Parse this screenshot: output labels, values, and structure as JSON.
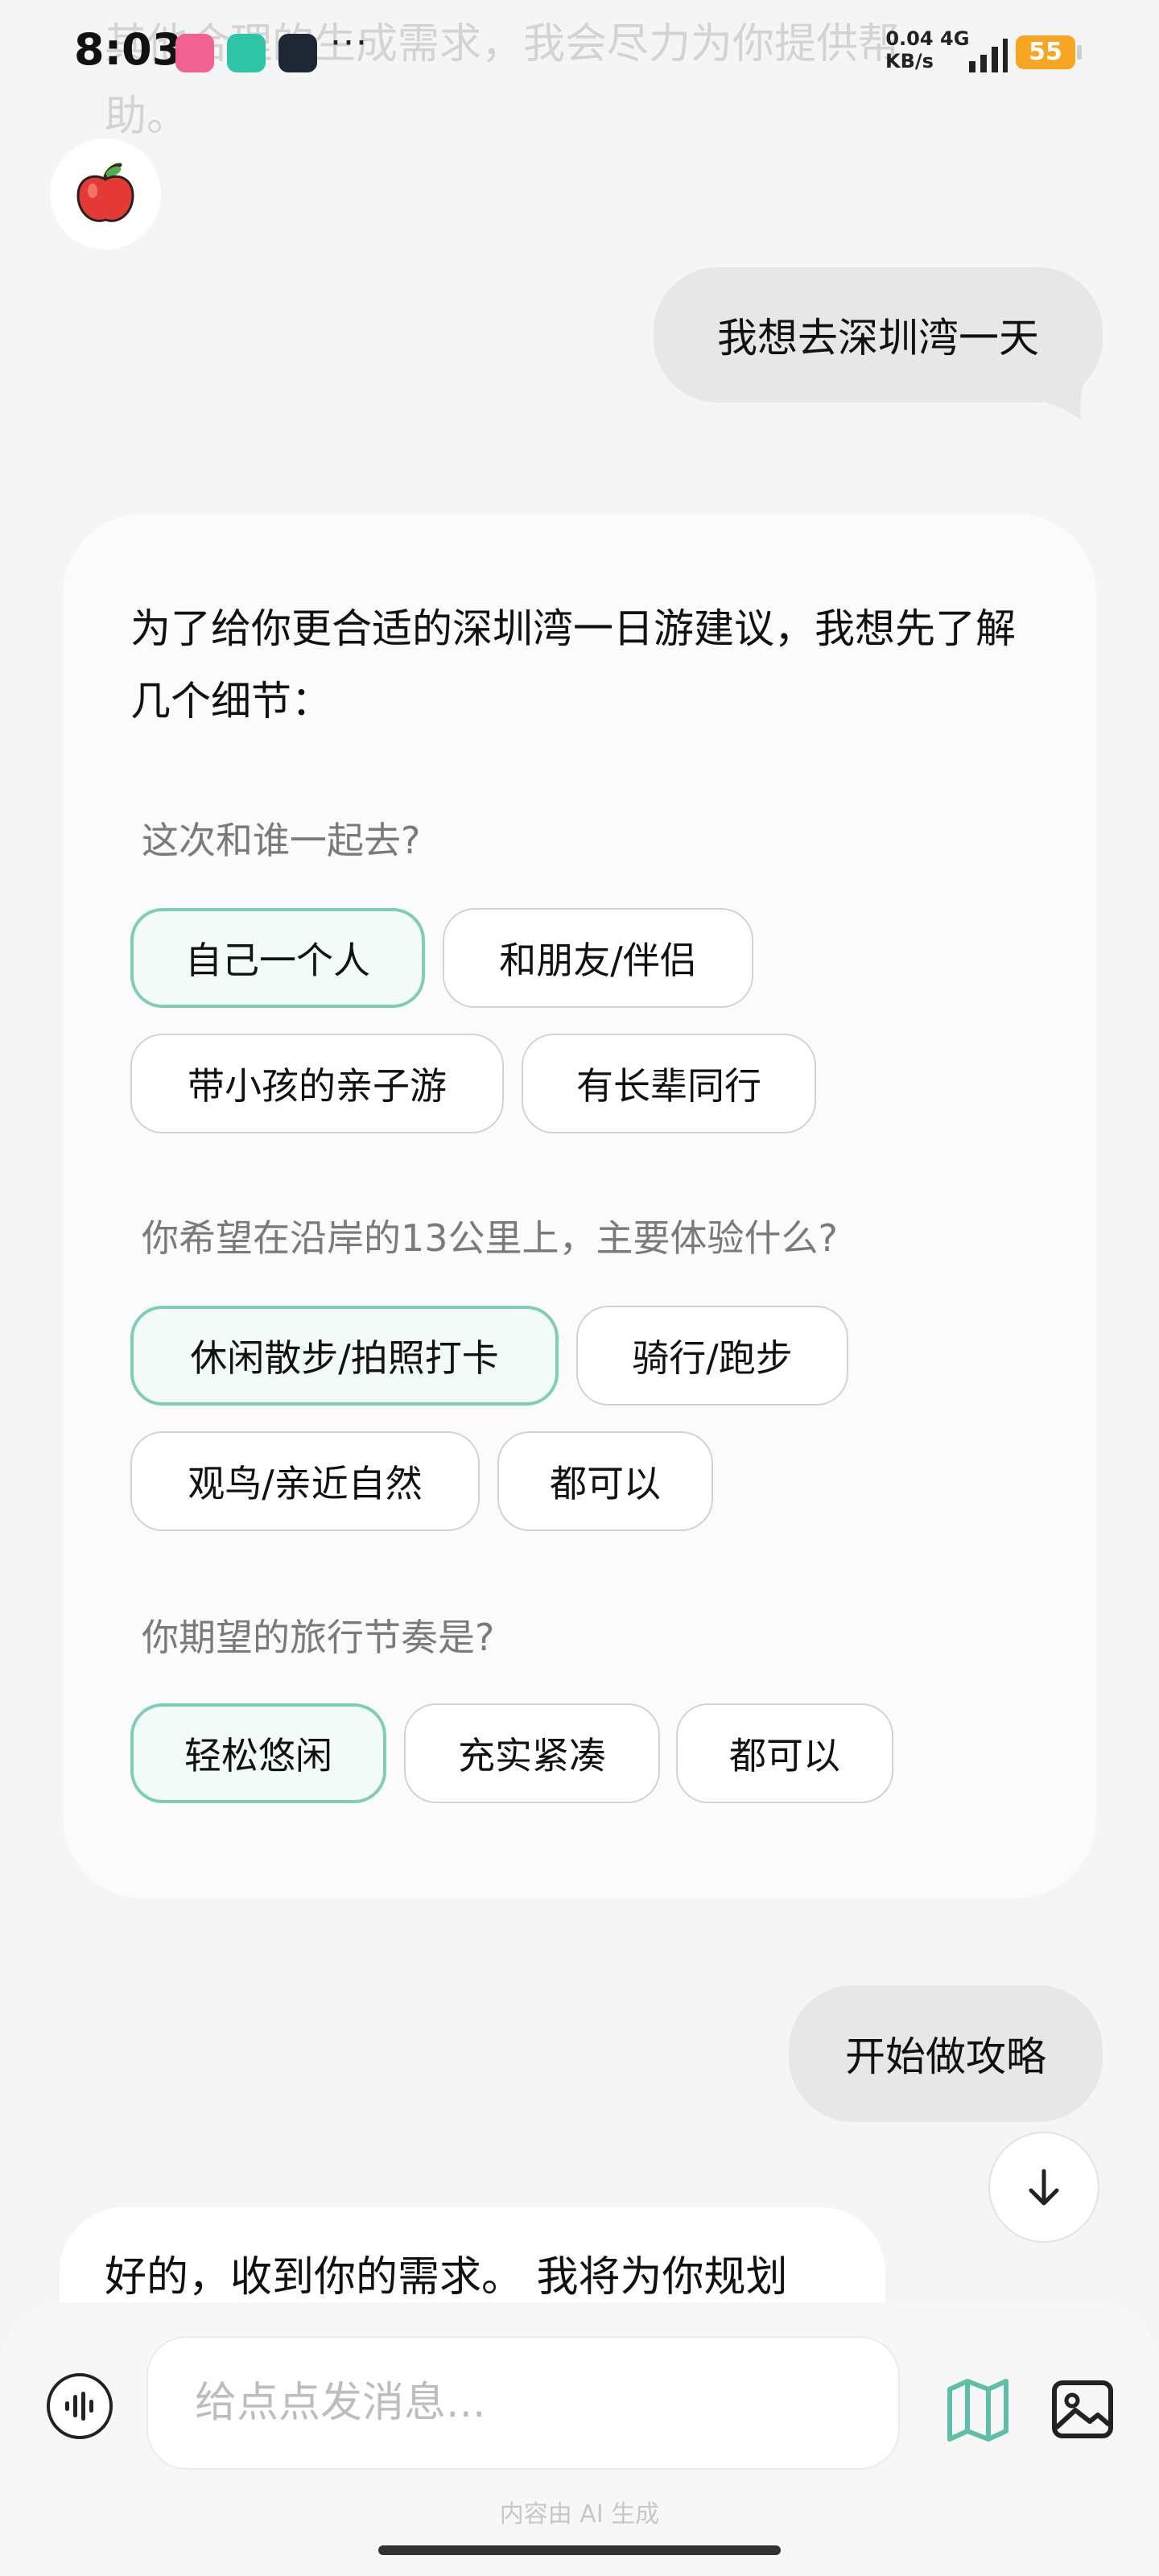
{
  "previous_message_faded": "其他合理的生成需求，我会尽力为你提供帮助。",
  "status_bar": {
    "time": "8:03",
    "more": "···",
    "net_speed_value": "0.04",
    "net_speed_unit": "KB/s",
    "network_type": "4G",
    "battery": "55"
  },
  "chat": {
    "user_message_1": "我想去深圳湾一天",
    "assistant_intro": "为了给你更合适的深圳湾一日游建议，我想先了解几个细节：",
    "questions": [
      {
        "label": "这次和谁一起去?",
        "options": [
          "自己一个人",
          "和朋友/伴侣",
          "带小孩的亲子游",
          "有长辈同行"
        ],
        "selected": "自己一个人"
      },
      {
        "label": "你希望在沿岸的13公里上，主要体验什么?",
        "options": [
          "休闲散步/拍照打卡",
          "骑行/跑步",
          "观鸟/亲近自然",
          "都可以"
        ],
        "selected": "休闲散步/拍照打卡"
      },
      {
        "label": "你期望的旅行节奏是?",
        "options": [
          "轻松悠闲",
          "充实紧凑",
          "都可以"
        ],
        "selected": "轻松悠闲"
      }
    ],
    "user_message_2": "开始做攻略",
    "assistant_reply_partial": "好的，收到你的需求。 我将为你规划"
  },
  "input": {
    "placeholder": "给点点发消息..."
  },
  "disclaimer": "内容由 AI 生成",
  "colors": {
    "selected_border": "#7dcdb8",
    "battery": "#f6a623",
    "map_icon": "#5dbfa6"
  }
}
